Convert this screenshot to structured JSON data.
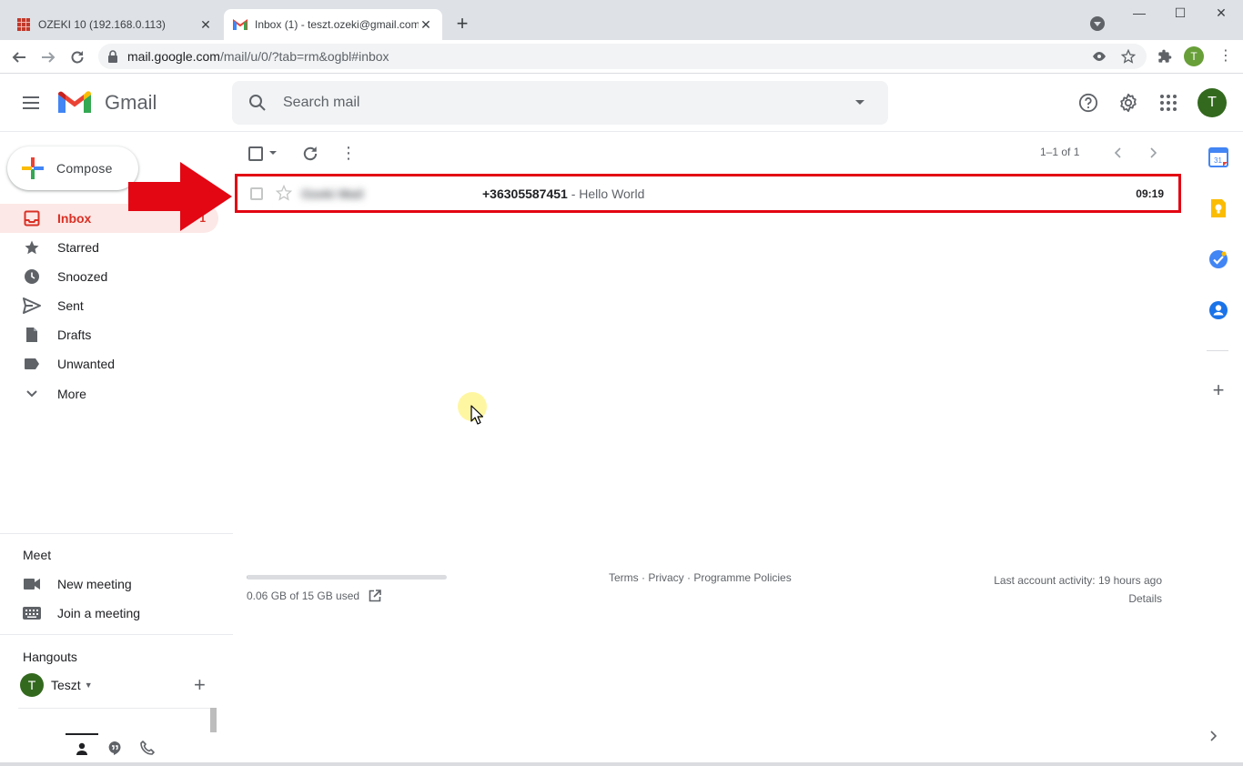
{
  "browser": {
    "tabs": [
      {
        "title": "OZEKI 10 (192.168.0.113)",
        "active": false
      },
      {
        "title": "Inbox (1) - teszt.ozeki@gmail.com",
        "active": true
      }
    ],
    "url_host": "mail.google.com",
    "url_path": "/mail/u/0/?tab=rm&ogbl#inbox",
    "profile_initial": "T"
  },
  "gmail": {
    "logo_text": "Gmail",
    "search_placeholder": "Search mail",
    "avatar_initial": "T",
    "compose_label": "Compose",
    "nav": [
      {
        "label": "Inbox",
        "icon": "inbox-icon",
        "count": "1",
        "active": true
      },
      {
        "label": "Starred",
        "icon": "star-icon"
      },
      {
        "label": "Snoozed",
        "icon": "clock-icon"
      },
      {
        "label": "Sent",
        "icon": "send-icon"
      },
      {
        "label": "Drafts",
        "icon": "draft-icon"
      },
      {
        "label": "Unwanted",
        "icon": "label-icon"
      },
      {
        "label": "More",
        "icon": "chevron-down-icon"
      }
    ],
    "meet": {
      "title": "Meet",
      "items": [
        {
          "label": "New meeting",
          "icon": "video-icon"
        },
        {
          "label": "Join a meeting",
          "icon": "keyboard-icon"
        }
      ]
    },
    "hangouts": {
      "title": "Hangouts",
      "user_initial": "T",
      "user_name": "Teszt"
    },
    "list": {
      "pager": "1–1 of 1",
      "messages": [
        {
          "sender": "Ozeki Mail",
          "subject": "+36305587451",
          "snippet": " - Hello World",
          "time": "09:19"
        }
      ]
    },
    "footer": {
      "storage_used": "0.06 GB of 15 GB used",
      "storage_fraction": 0.004,
      "links": "Terms · Privacy · Programme Policies",
      "activity": "Last account activity: 19 hours ago",
      "details": "Details"
    }
  },
  "colors": {
    "accent_red": "#d93025",
    "highlight_box": "#e30613",
    "arrow": "#e30613"
  }
}
